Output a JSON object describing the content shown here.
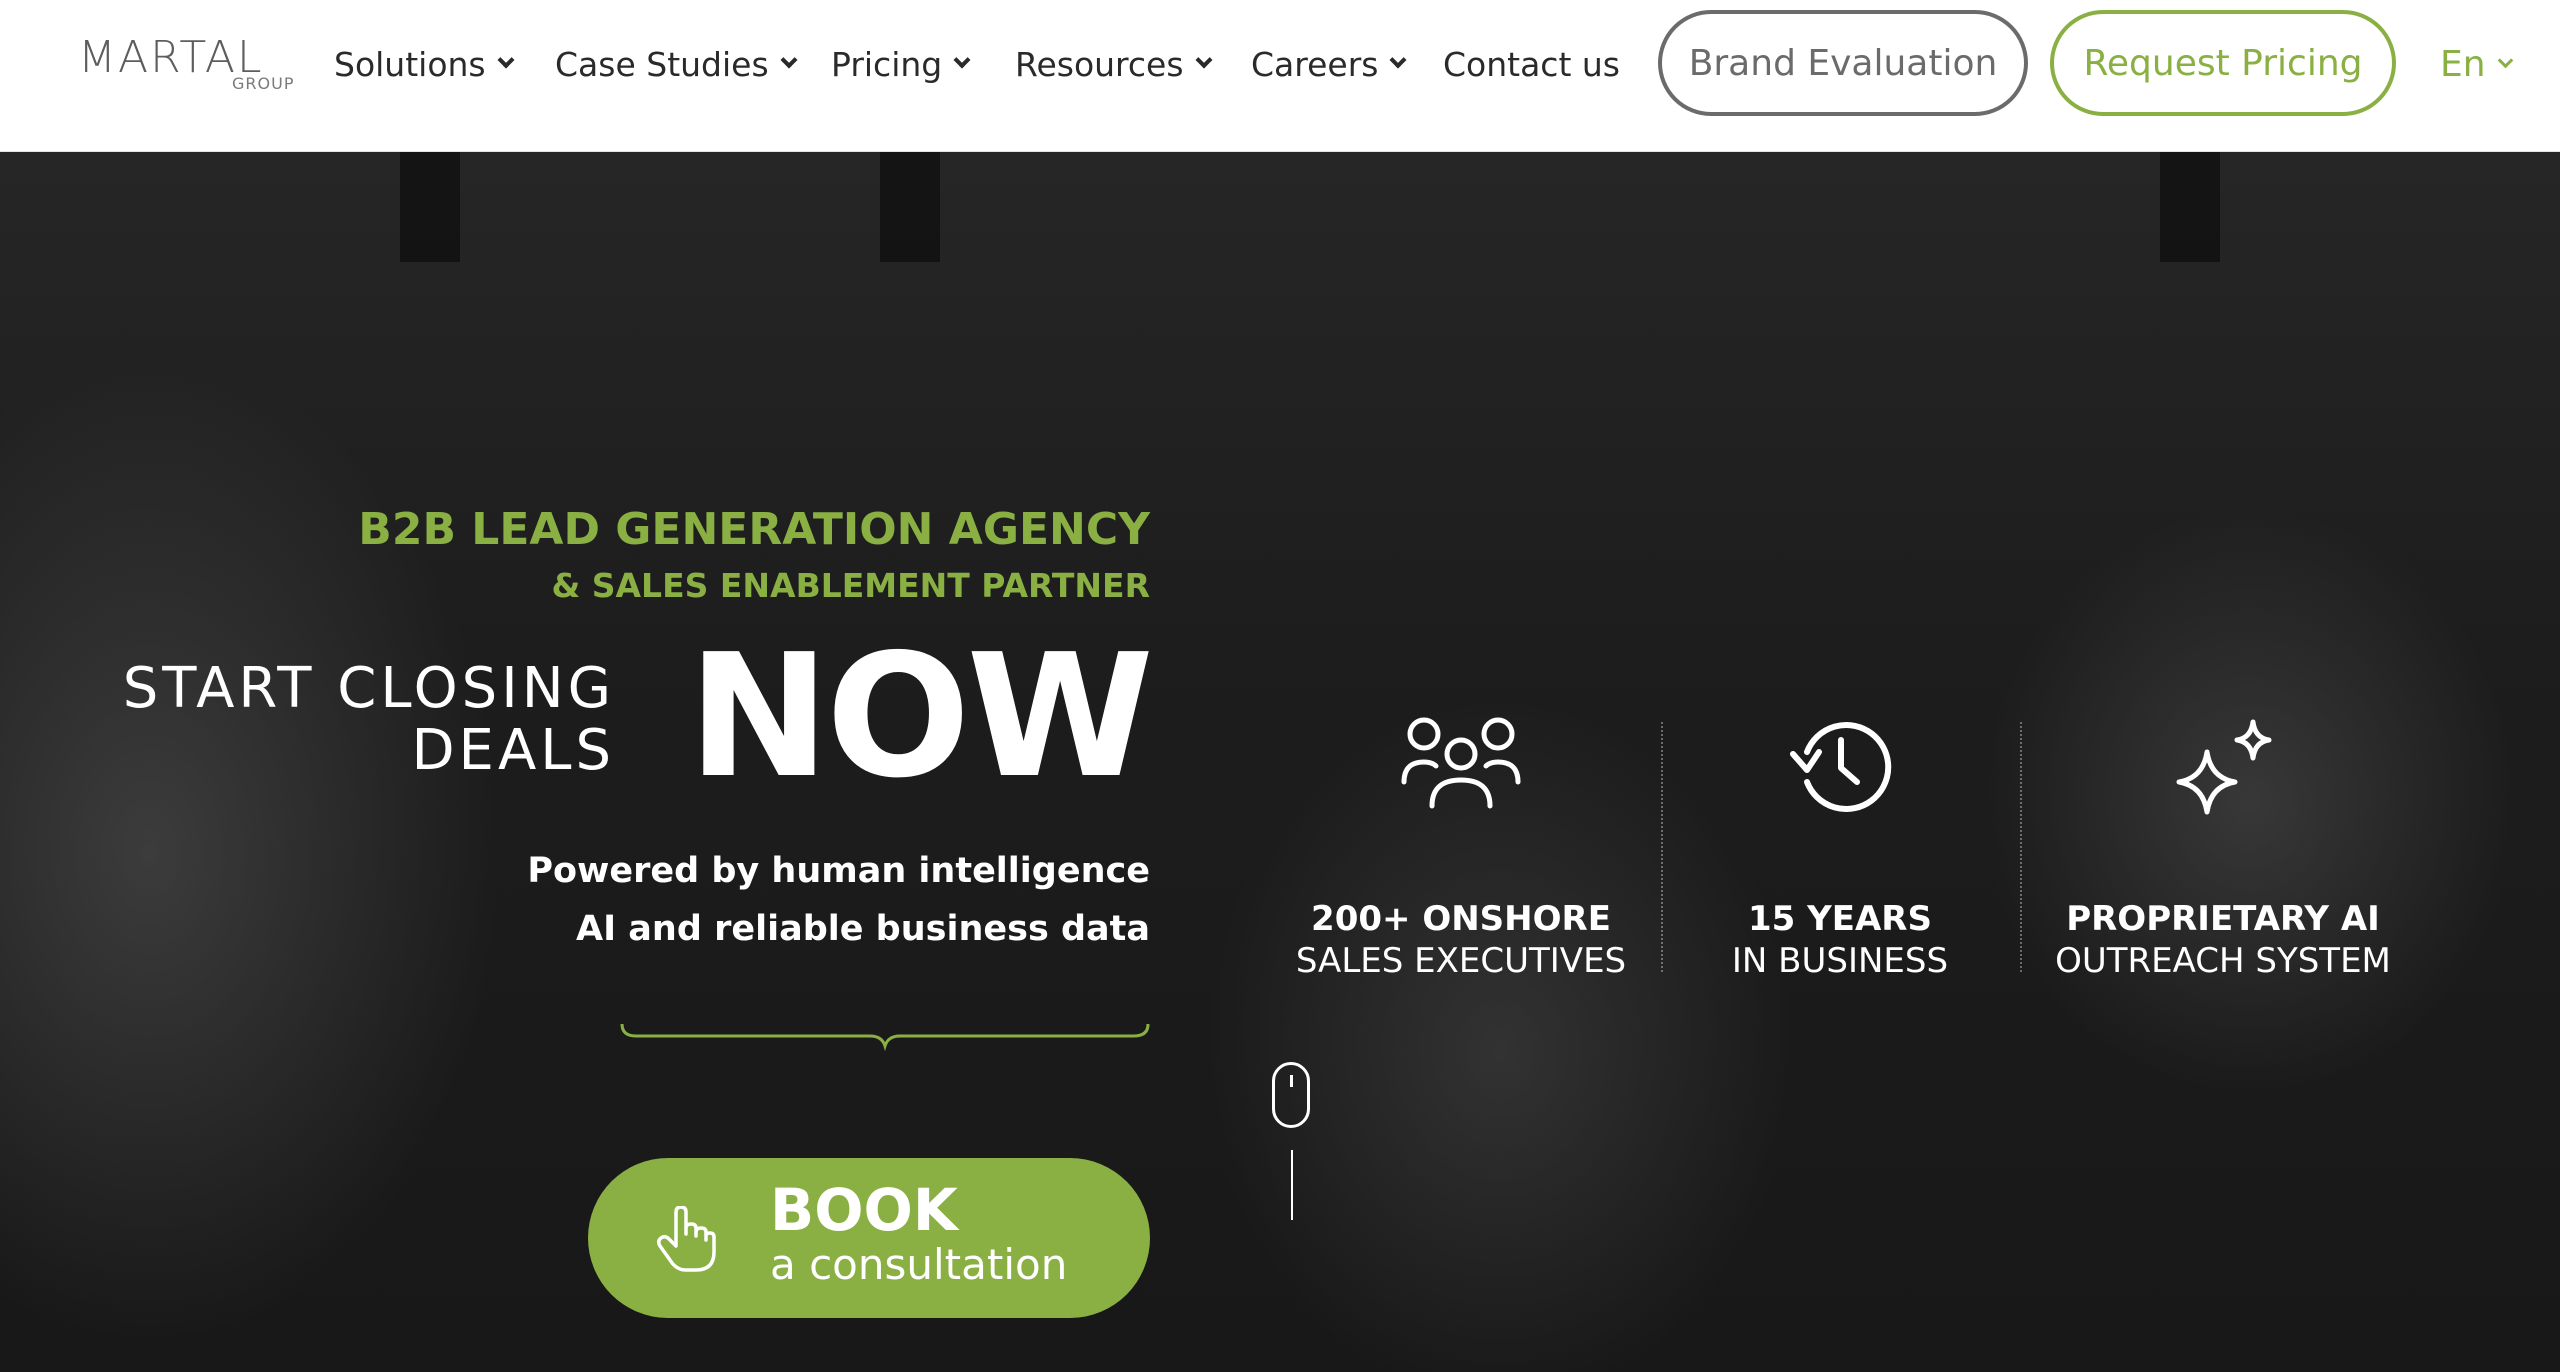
{
  "logo": {
    "name": "MARTAL",
    "sub": "GROUP"
  },
  "nav": {
    "items": [
      {
        "label": "Solutions",
        "dropdown": true
      },
      {
        "label": "Case Studies",
        "dropdown": true
      },
      {
        "label": "Pricing",
        "dropdown": true
      },
      {
        "label": "Resources",
        "dropdown": true
      },
      {
        "label": "Careers",
        "dropdown": true
      },
      {
        "label": "Contact us",
        "dropdown": false
      }
    ],
    "brand_evaluation": "Brand Evaluation",
    "request_pricing": "Request Pricing",
    "language": "En"
  },
  "hero": {
    "tagline": "B2B LEAD GENERATION AGENCY",
    "tagline_sub": "& SALES ENABLEMENT PARTNER",
    "start_line1": "START CLOSING",
    "start_line2": "DEALS",
    "now": "NOW",
    "powered_line1": "Powered by human intelligence",
    "powered_line2": "AI and reliable business data",
    "cta": {
      "label": "BOOK",
      "sub": "a consultation"
    }
  },
  "stats": [
    {
      "icon": "people-group-icon",
      "strong": "200+ ONSHORE",
      "light": "SALES EXECUTIVES"
    },
    {
      "icon": "clock-history-icon",
      "strong": "15 YEARS",
      "light": "IN BUSINESS"
    },
    {
      "icon": "sparkles-icon",
      "strong": "PROPRIETARY AI",
      "light": "OUTREACH SYSTEM"
    }
  ],
  "colors": {
    "accent": "#8ab043",
    "header_bg": "#ffffff",
    "hero_bg": "#1c1c1c"
  }
}
